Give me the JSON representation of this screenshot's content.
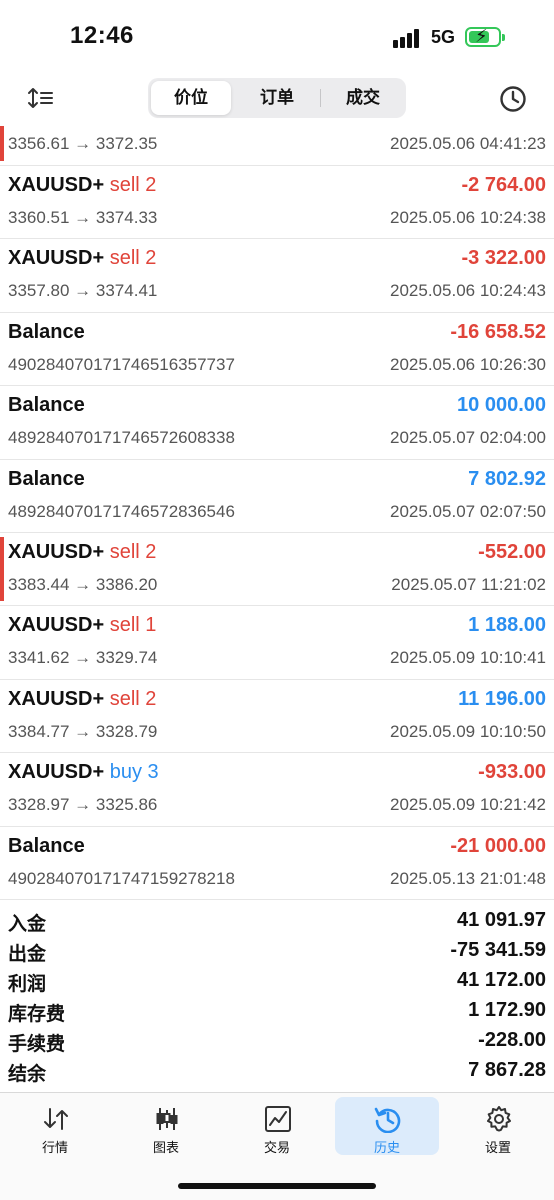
{
  "status": {
    "time": "12:46",
    "network": "5G"
  },
  "toolbar": {
    "tabs": [
      "价位",
      "订单",
      "成交"
    ],
    "active_tab": "价位"
  },
  "trades": [
    {
      "symbol": "",
      "direction": "",
      "direction_type": "",
      "profit": "",
      "profit_sign": "",
      "sub": "3356.61 → 3372.35",
      "date": "2025.05.06 04:41:23",
      "marker": true
    },
    {
      "symbol": "XAUUSD+",
      "direction": "sell 2",
      "direction_type": "sell",
      "profit": "-2 764.00",
      "profit_sign": "neg",
      "sub": "3360.51 → 3374.33",
      "date": "2025.05.06 10:24:38",
      "marker": false
    },
    {
      "symbol": "XAUUSD+",
      "direction": "sell 2",
      "direction_type": "sell",
      "profit": "-3 322.00",
      "profit_sign": "neg",
      "sub": "3357.80 → 3374.41",
      "date": "2025.05.06 10:24:43",
      "marker": false
    },
    {
      "symbol": "Balance",
      "direction": "",
      "direction_type": "",
      "profit": "-16 658.52",
      "profit_sign": "neg",
      "sub": "49028407017174651635773​7",
      "date": "2025.05.06 10:26:30",
      "marker": false
    },
    {
      "symbol": "Balance",
      "direction": "",
      "direction_type": "",
      "profit": "10 000.00",
      "profit_sign": "pos",
      "sub": "489284070171746572608338",
      "date": "2025.05.07 02:04:00",
      "marker": false
    },
    {
      "symbol": "Balance",
      "direction": "",
      "direction_type": "",
      "profit": "7 802.92",
      "profit_sign": "pos",
      "sub": "489284070171746572836546",
      "date": "2025.05.07 02:07:50",
      "marker": false
    },
    {
      "symbol": "XAUUSD+",
      "direction": "sell 2",
      "direction_type": "sell",
      "profit": "-552.00",
      "profit_sign": "neg",
      "sub": "3383.44 → 3386.20",
      "date": "2025.05.07 11:21:02",
      "marker": true
    },
    {
      "symbol": "XAUUSD+",
      "direction": "sell 1",
      "direction_type": "sell",
      "profit": "1 188.00",
      "profit_sign": "pos",
      "sub": "3341.62 → 3329.74",
      "date": "2025.05.09 10:10:41",
      "marker": false
    },
    {
      "symbol": "XAUUSD+",
      "direction": "sell 2",
      "direction_type": "sell",
      "profit": "11 196.00",
      "profit_sign": "pos",
      "sub": "3384.77 → 3328.79",
      "date": "2025.05.09 10:10:50",
      "marker": false
    },
    {
      "symbol": "XAUUSD+",
      "direction": "buy 3",
      "direction_type": "buy",
      "profit": "-933.00",
      "profit_sign": "neg",
      "sub": "3328.97 → 3325.86",
      "date": "2025.05.09 10:21:42",
      "marker": false
    },
    {
      "symbol": "Balance",
      "direction": "",
      "direction_type": "",
      "profit": "-21 000.00",
      "profit_sign": "neg",
      "sub": "490284070171747159278218",
      "date": "2025.05.13 21:01:48",
      "marker": false
    }
  ],
  "summary": [
    {
      "label": "入金",
      "value": "41 091.97"
    },
    {
      "label": "出金",
      "value": "-75 341.59"
    },
    {
      "label": "利润",
      "value": "41 172.00"
    },
    {
      "label": "库存费",
      "value": "1 172.90"
    },
    {
      "label": "手续费",
      "value": "-228.00"
    },
    {
      "label": "结余",
      "value": "7 867.28"
    }
  ],
  "tabbar": {
    "items": [
      {
        "label": "行情",
        "icon": "quotes-icon"
      },
      {
        "label": "图表",
        "icon": "chart-icon"
      },
      {
        "label": "交易",
        "icon": "trade-icon"
      },
      {
        "label": "历史",
        "icon": "history-icon"
      },
      {
        "label": "设置",
        "icon": "settings-icon"
      }
    ],
    "active": "历史"
  },
  "colors": {
    "negative": "#e0443a",
    "positive": "#2a8ef0",
    "accent": "#2a8ef0",
    "battery": "#34c759"
  }
}
